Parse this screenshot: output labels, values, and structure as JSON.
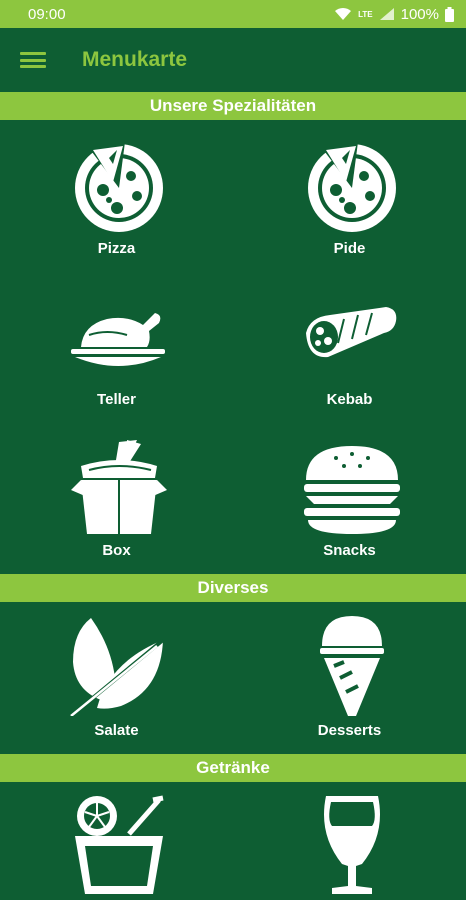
{
  "status_bar": {
    "time": "09:00",
    "network": "LTE",
    "battery": "100%"
  },
  "app_bar": {
    "title": "Menukarte"
  },
  "sections": [
    {
      "title": "Unsere Spezialitäten",
      "items": [
        {
          "label": "Pizza",
          "icon": "pizza-icon"
        },
        {
          "label": "Pide",
          "icon": "pide-icon"
        },
        {
          "label": "Teller",
          "icon": "roast-chicken-icon"
        },
        {
          "label": "Kebab",
          "icon": "kebab-wrap-icon"
        },
        {
          "label": "Box",
          "icon": "noodle-box-icon"
        },
        {
          "label": "Snacks",
          "icon": "burger-icon"
        }
      ]
    },
    {
      "title": "Diverses",
      "items": [
        {
          "label": "Salate",
          "icon": "leaf-icon"
        },
        {
          "label": "Desserts",
          "icon": "ice-cream-icon"
        }
      ]
    },
    {
      "title": "Getränke",
      "items": [
        {
          "label": "",
          "icon": "juice-glass-icon"
        },
        {
          "label": "",
          "icon": "wine-glass-icon"
        }
      ]
    }
  ],
  "colors": {
    "background": "#0e5e33",
    "accent": "#8dc63f",
    "text": "#ffffff"
  }
}
